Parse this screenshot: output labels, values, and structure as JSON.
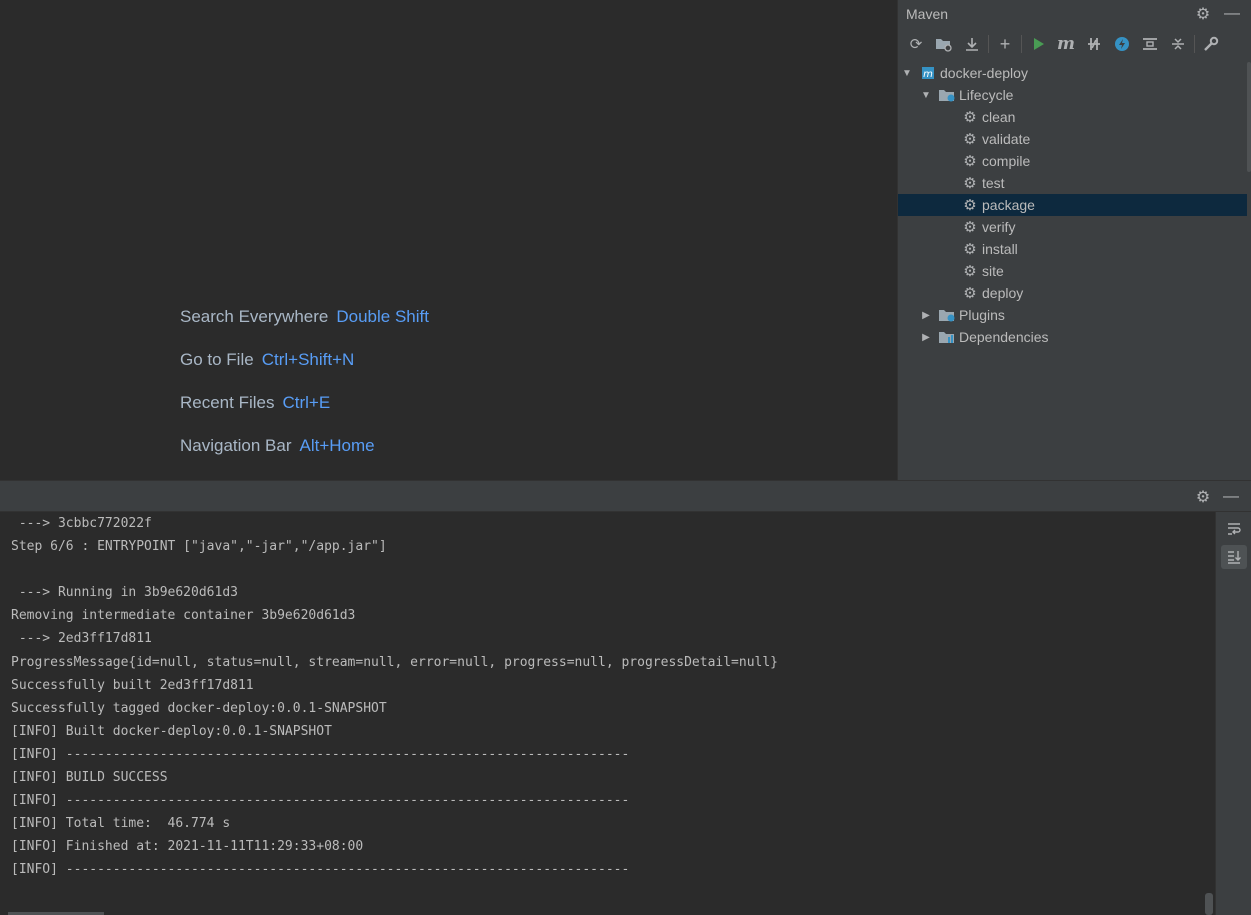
{
  "editor": {
    "hints": [
      {
        "label": "Search Everywhere",
        "shortcut": "Double Shift"
      },
      {
        "label": "Go to File",
        "shortcut": "Ctrl+Shift+N"
      },
      {
        "label": "Recent Files",
        "shortcut": "Ctrl+E"
      },
      {
        "label": "Navigation Bar",
        "shortcut": "Alt+Home"
      }
    ]
  },
  "maven": {
    "title": "Maven",
    "project": "docker-deploy",
    "lifecycle_label": "Lifecycle",
    "phases": [
      "clean",
      "validate",
      "compile",
      "test",
      "package",
      "verify",
      "install",
      "site",
      "deploy"
    ],
    "selected_phase": "package",
    "plugins_label": "Plugins",
    "dependencies_label": "Dependencies"
  },
  "console": {
    "lines": [
      " ---> 3cbbc772022f",
      "Step 6/6 : ENTRYPOINT [\"java\",\"-jar\",\"/app.jar\"]",
      "",
      " ---> Running in 3b9e620d61d3",
      "Removing intermediate container 3b9e620d61d3",
      " ---> 2ed3ff17d811",
      "ProgressMessage{id=null, status=null, stream=null, error=null, progress=null, progressDetail=null}",
      "Successfully built 2ed3ff17d811",
      "Successfully tagged docker-deploy:0.0.1-SNAPSHOT",
      "[INFO] Built docker-deploy:0.0.1-SNAPSHOT",
      "[INFO] ------------------------------------------------------------------------",
      "[INFO] BUILD SUCCESS",
      "[INFO] ------------------------------------------------------------------------",
      "[INFO] Total time:  46.774 s",
      "[INFO] Finished at: 2021-11-11T11:29:33+08:00",
      "[INFO] ------------------------------------------------------------------------"
    ]
  },
  "colors": {
    "accent": "#589df6",
    "panel": "#3c3f41",
    "editor_bg": "#2b2b2b",
    "selection": "#0d293e",
    "run_green": "#499c54",
    "maven_blue": "#3592c4"
  }
}
